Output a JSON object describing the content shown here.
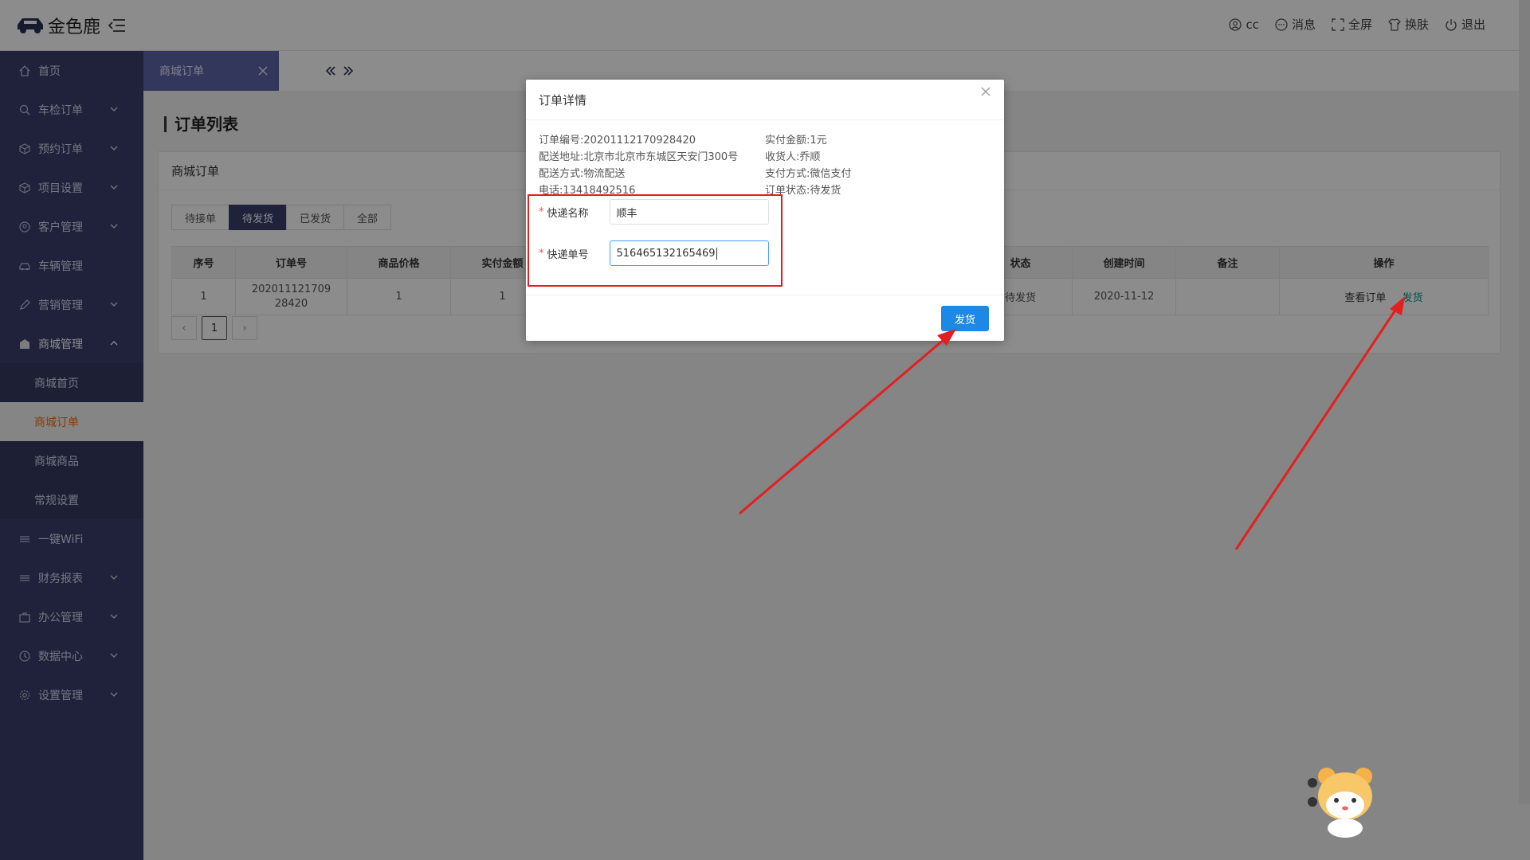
{
  "header": {
    "logo_text": "金色鹿",
    "items": [
      {
        "icon": "user-icon",
        "label": "cc"
      },
      {
        "icon": "message-icon",
        "label": "消息"
      },
      {
        "icon": "fullscreen-icon",
        "label": "全屏"
      },
      {
        "icon": "shirt-icon",
        "label": "换肤"
      },
      {
        "icon": "power-icon",
        "label": "退出"
      }
    ]
  },
  "sidebar": {
    "items": [
      {
        "label": "首页",
        "icon": "home-icon"
      },
      {
        "label": "车检订单",
        "icon": "search-icon"
      },
      {
        "label": "预约订单",
        "icon": "cube-icon"
      },
      {
        "label": "项目设置",
        "icon": "cube-icon"
      },
      {
        "label": "客户管理",
        "icon": "user-circle-icon"
      },
      {
        "label": "车辆管理",
        "icon": "car-icon"
      },
      {
        "label": "营销管理",
        "icon": "pen-icon"
      },
      {
        "label": "商城管理",
        "icon": "shop-icon"
      },
      {
        "label": "一键WiFi",
        "icon": "list-icon"
      },
      {
        "label": "财务报表",
        "icon": "list-icon"
      },
      {
        "label": "办公管理",
        "icon": "briefcase-icon"
      },
      {
        "label": "数据中心",
        "icon": "clock-icon"
      },
      {
        "label": "设置管理",
        "icon": "gear-icon"
      }
    ],
    "sub_items": [
      "商城首页",
      "商城订单",
      "商城商品",
      "常规设置"
    ]
  },
  "tabstrip": {
    "active_tab": "商城订单"
  },
  "page": {
    "title": "订单列表",
    "card_title": "商城订单",
    "status_tabs": [
      "待接单",
      "待发货",
      "已发货",
      "全部"
    ],
    "active_status_tab": "待发货",
    "table": {
      "headers": [
        "序号",
        "订单号",
        "商品价格",
        "实付金额",
        "",
        "",
        "",
        "",
        "状态",
        "创建时间",
        "备注",
        "操作"
      ],
      "row": {
        "index": "1",
        "order_no_line1": "202011121709",
        "order_no_line2": "28420",
        "price": "1",
        "paid": "1",
        "status": "待发货",
        "created": "2020-11-12",
        "remark": "",
        "action_view": "查看订单",
        "action_ship": "发货"
      }
    },
    "pager": {
      "prev": "‹",
      "current": "1",
      "next": "›"
    }
  },
  "modal": {
    "title": "订单详情",
    "info_left": [
      "订单编号:20201112170928420",
      "配送地址:北京市北京市东城区天安门300号",
      "配送方式:物流配送",
      "电话:13418492516"
    ],
    "info_right": [
      "实付金额:1元",
      "收货人:乔顺",
      "支付方式:微信支付",
      "订单状态:待发货"
    ],
    "form": {
      "courier_label": "快递名称",
      "courier_value": "顺丰",
      "tracking_label": "快递单号",
      "tracking_value": "516465132165469",
      "required_mark": "*"
    },
    "submit_label": "发货"
  },
  "colors": {
    "sidebar_bg": "#3a3e6b",
    "active_tab_bg": "#5d64a8",
    "ship_button": "#1e88e5",
    "highlight_red": "#e31f1f",
    "ship_link": "#009688"
  }
}
